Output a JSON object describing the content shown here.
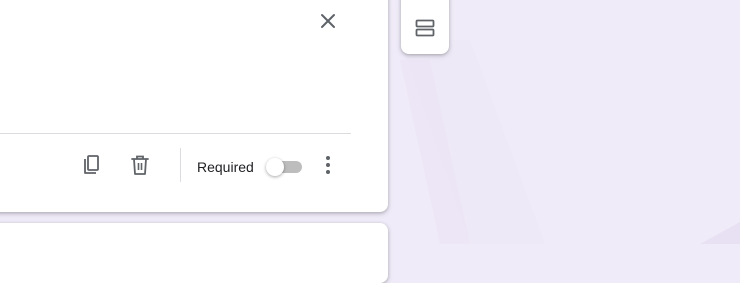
{
  "question_card": {
    "required_label": "Required",
    "required_on": false
  },
  "icons": {
    "close": "close-icon",
    "duplicate": "copy-icon",
    "delete": "trash-icon",
    "more": "more-vert-icon",
    "add_section": "section-icon"
  },
  "colors": {
    "page_background": "#f0ebf8",
    "card_background": "#ffffff",
    "icon": "#5f6368",
    "divider": "#dadce0",
    "toggle_track_off": "#bdbdbd"
  }
}
